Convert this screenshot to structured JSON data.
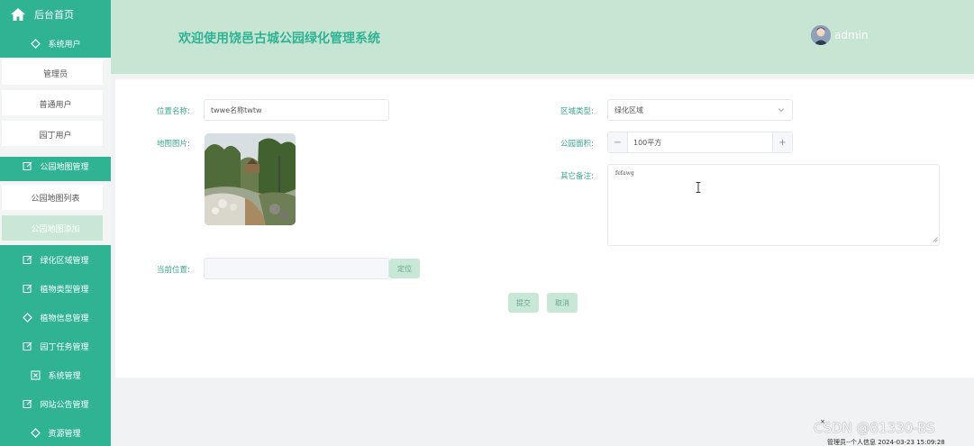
{
  "sidebar": {
    "home_label": "后台首页",
    "groups": [
      {
        "label": "系统用户",
        "icon": "diamond-icon"
      },
      {
        "label": "公园地图管理",
        "icon": "edit-icon"
      },
      {
        "label": "绿化区域管理",
        "icon": "edit-icon"
      },
      {
        "label": "植物类型管理",
        "icon": "edit-icon"
      },
      {
        "label": "植物信息管理",
        "icon": "diamond-icon"
      },
      {
        "label": "园丁任务管理",
        "icon": "edit-icon"
      },
      {
        "label": "系统管理",
        "icon": "x-square-icon"
      },
      {
        "label": "网站公告管理",
        "icon": "edit-icon"
      },
      {
        "label": "资源管理",
        "icon": "diamond-icon"
      }
    ],
    "user_items": [
      "管理员",
      "普通用户",
      "园丁用户"
    ],
    "map_items": [
      "公园地图列表",
      "公园地图添加"
    ]
  },
  "header": {
    "title": "欢迎使用饶邑古城公园绿化管理系统",
    "username": "admin"
  },
  "form": {
    "location_name_label": "位置名称:",
    "location_name_value": "twwe名称twtw",
    "area_type_label": "区域类型:",
    "area_type_value": "绿化区域",
    "map_image_label": "地图图片:",
    "park_area_label": "公园面积:",
    "park_area_value": "100平方",
    "stepper_minus": "−",
    "stepper_plus": "+",
    "remarks_label": "其它备注:",
    "remarks_value": "fefawg",
    "current_position_label": "当前位置:",
    "locate_button": "定位",
    "submit_button": "提交",
    "cancel_button": "取消"
  },
  "watermark": "CSDN @81330-BS",
  "footer_text": "管理员--个人信息 2024-03-23 15:09:28",
  "close_glyph": "×",
  "colors": {
    "accent": "#2fb393",
    "header_bg": "#c7e5d3",
    "button_bg": "#c9e7d6"
  }
}
